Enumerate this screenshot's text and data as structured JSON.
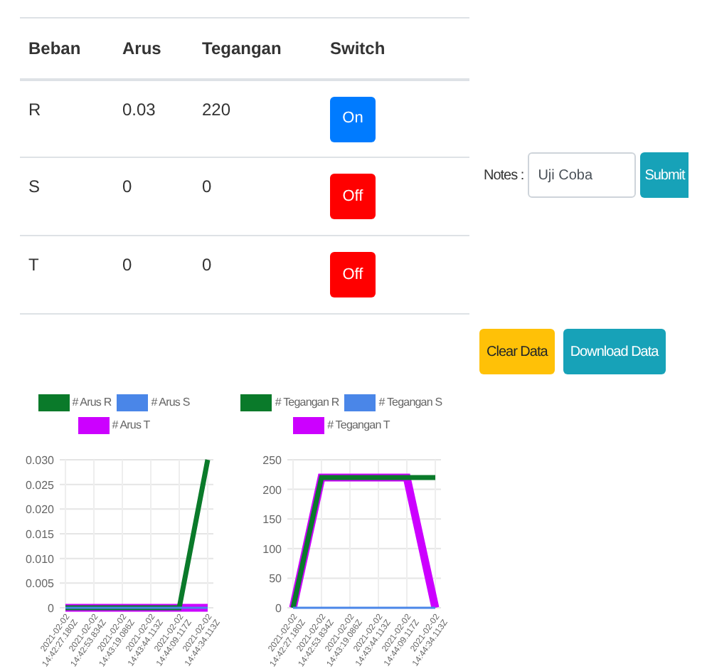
{
  "table": {
    "columns": [
      "Beban",
      "Arus",
      "Tegangan",
      "Switch"
    ],
    "rows": [
      {
        "beban": "R",
        "arus": "0.03",
        "tegangan": "220",
        "switch": "On",
        "on": true
      },
      {
        "beban": "S",
        "arus": "0",
        "tegangan": "0",
        "switch": "Off",
        "on": false
      },
      {
        "beban": "T",
        "arus": "0",
        "tegangan": "0",
        "switch": "Off",
        "on": false
      }
    ]
  },
  "notes": {
    "label": "Notes :",
    "value": "Uji Coba",
    "submit": "Submit"
  },
  "actions": [
    {
      "label": "Clear Data",
      "kind": "warning"
    },
    {
      "label": "Download Data",
      "kind": "info"
    }
  ],
  "charts": [
    {
      "chart_data": {
        "type": "line",
        "categories": [
          "2021-02-02 14:42:27.180Z",
          "2021-02-02 14:42:53.834Z",
          "2021-02-02 14:43:19.086Z",
          "2021-02-02 14:43:44.113Z",
          "2021-02-02 14:44:09.117Z",
          "2021-02-02 14:44:34.113Z"
        ],
        "series": [
          {
            "name": "# Arus R",
            "color": "#0a7a2a",
            "values": [
              0,
              0,
              0,
              0,
              0,
              0.03
            ]
          },
          {
            "name": "# Arus S",
            "color": "#4a86e8",
            "values": [
              0,
              0,
              0,
              0,
              0,
              0
            ]
          },
          {
            "name": "# Arus T",
            "color": "#cc00ff",
            "values": [
              0,
              0,
              0,
              0,
              0,
              0
            ]
          }
        ],
        "grid": true,
        "legend": true,
        "ylim": [
          0,
          0.03
        ],
        "yticks": [
          {
            "value": 0,
            "label": "0"
          },
          {
            "value": 0.005,
            "label": "0.005"
          },
          {
            "value": 0.01,
            "label": "0.010"
          },
          {
            "value": 0.015,
            "label": "0.015"
          },
          {
            "value": 0.02,
            "label": "0.020"
          },
          {
            "value": 0.025,
            "label": "0.025"
          },
          {
            "value": 0.03,
            "label": "0.030"
          }
        ]
      }
    },
    {
      "chart_data": {
        "type": "line",
        "categories": [
          "2021-02-02 14:42:27.180Z",
          "2021-02-02 14:42:53.834Z",
          "2021-02-02 14:43:19.086Z",
          "2021-02-02 14:43:44.113Z",
          "2021-02-02 14:44:09.117Z",
          "2021-02-02 14:44:34.113Z"
        ],
        "series": [
          {
            "name": "# Tegangan R",
            "color": "#0a7a2a",
            "values": [
              0,
              220,
              220,
              220,
              220,
              220
            ]
          },
          {
            "name": "# Tegangan S",
            "color": "#4a86e8",
            "values": [
              0,
              0,
              0,
              0,
              0,
              0
            ]
          },
          {
            "name": "# Tegangan T",
            "color": "#cc00ff",
            "values": [
              0,
              220,
              220,
              220,
              220,
              0
            ]
          }
        ],
        "grid": true,
        "legend": true,
        "ylim": [
          0,
          250
        ],
        "yticks": [
          0,
          50,
          100,
          150,
          200,
          250
        ]
      }
    }
  ]
}
